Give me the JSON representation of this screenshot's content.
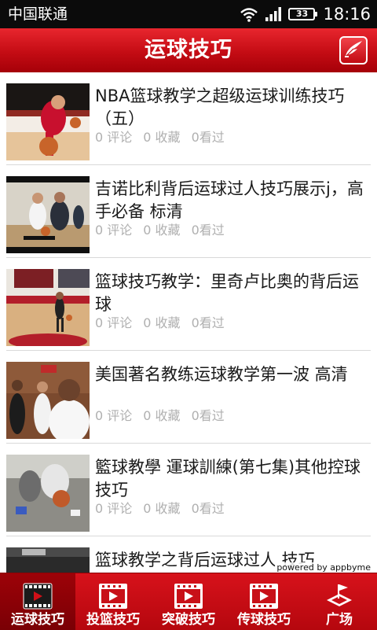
{
  "status_bar": {
    "carrier": "中国联通",
    "battery": "33",
    "time": "18:16"
  },
  "header": {
    "title": "运球技巧",
    "share_icon": "share-feather-icon"
  },
  "items": [
    {
      "title": "NBA篮球教学之超级运球训练技巧（五）",
      "comments": "0 评论",
      "favorites": "0 收藏",
      "views": "0看过"
    },
    {
      "title": "吉诺比利背后运球过人技巧展示j，高手必备 标清",
      "comments": "0 评论",
      "favorites": "0 收藏",
      "views": "0看过"
    },
    {
      "title": "篮球技巧教学：里奇卢比奥的背后运球",
      "comments": "0 评论",
      "favorites": "0 收藏",
      "views": "0看过"
    },
    {
      "title": "美国著名教练运球教学第一波 高清",
      "comments": "0 评论",
      "favorites": "0 收藏",
      "views": "0看过"
    },
    {
      "title": "籃球教學 運球訓練(第七集)其他控球技巧",
      "comments": "0 评论",
      "favorites": "0 收藏",
      "views": "0看过"
    },
    {
      "title": "篮球教学之背后运球过人 技巧",
      "comments": "",
      "favorites": "",
      "views": ""
    }
  ],
  "powered_by": "powered by appbyme",
  "tabs": [
    {
      "label": "运球技巧",
      "icon": "video-icon",
      "active": true
    },
    {
      "label": "投篮技巧",
      "icon": "video-icon",
      "active": false
    },
    {
      "label": "突破技巧",
      "icon": "video-icon",
      "active": false
    },
    {
      "label": "传球技巧",
      "icon": "video-icon",
      "active": false
    },
    {
      "label": "广场",
      "icon": "square-icon",
      "active": false
    }
  ],
  "colors": {
    "accent": "#c40c14",
    "meta_text": "#b0b0b0"
  }
}
